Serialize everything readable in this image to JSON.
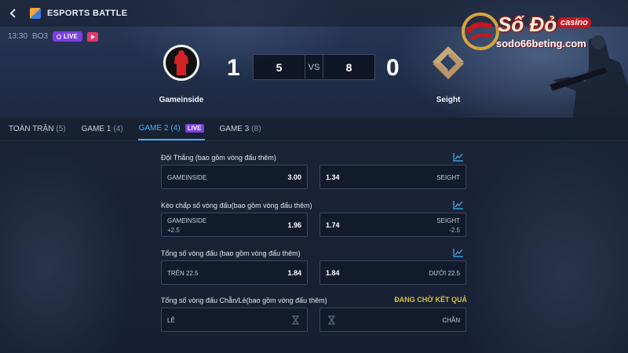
{
  "header": {
    "title": "ESPORTS BATTLE",
    "time": "13:30",
    "format": "BO3",
    "live_label": "LIVE"
  },
  "match": {
    "team_left": "Gameinside",
    "team_right": "Seight",
    "score_left": "1",
    "score_right": "0",
    "rounds_left": "5",
    "vs": "VS",
    "rounds_right": "8"
  },
  "brand": {
    "name": "Số Đỏ",
    "tag": "casino",
    "url": "sodo66beting.com"
  },
  "tabs": [
    {
      "label": "TOÀN TRẬN",
      "count": "(5)"
    },
    {
      "label": "GAME 1",
      "count": "(4)"
    },
    {
      "label": "GAME 2",
      "count": "(4)",
      "live": "LIVE"
    },
    {
      "label": "GAME 3",
      "count": "(8)"
    }
  ],
  "markets": [
    {
      "title": "Đội Thắng (bao gồm vòng đấu thêm)",
      "left": {
        "name": "GAMEINSIDE",
        "sub": "",
        "price": "3.00"
      },
      "right": {
        "name": "SEIGHT",
        "sub": "",
        "price": "1.34"
      }
    },
    {
      "title": "Kèo chấp số vòng đấu(bao gồm vòng đấu thêm)",
      "left": {
        "name": "GAMEINSIDE",
        "sub": "+2.5",
        "price": "1.96"
      },
      "right": {
        "name": "SEIGHT",
        "sub": "-2.5",
        "price": "1.74"
      }
    },
    {
      "title": "Tổng số vòng đấu (bao gồm vòng đấu thêm)",
      "left": {
        "name": "TRÊN 22.5",
        "sub": "",
        "price": "1.84"
      },
      "right": {
        "name": "DƯỚI 22.5",
        "sub": "",
        "price": "1.84"
      }
    },
    {
      "title": "Tổng số vòng đấu Chẵn/Lẻ(bao gồm vòng đấu thêm)",
      "status": "ĐANG CHỜ KẾT QUẢ",
      "left": {
        "name": "LẺ"
      },
      "right": {
        "name": "CHẴN"
      }
    }
  ],
  "colors": {
    "accent": "#3fb4ff",
    "live": "#7b3fe4",
    "pending": "#d8c23a"
  }
}
